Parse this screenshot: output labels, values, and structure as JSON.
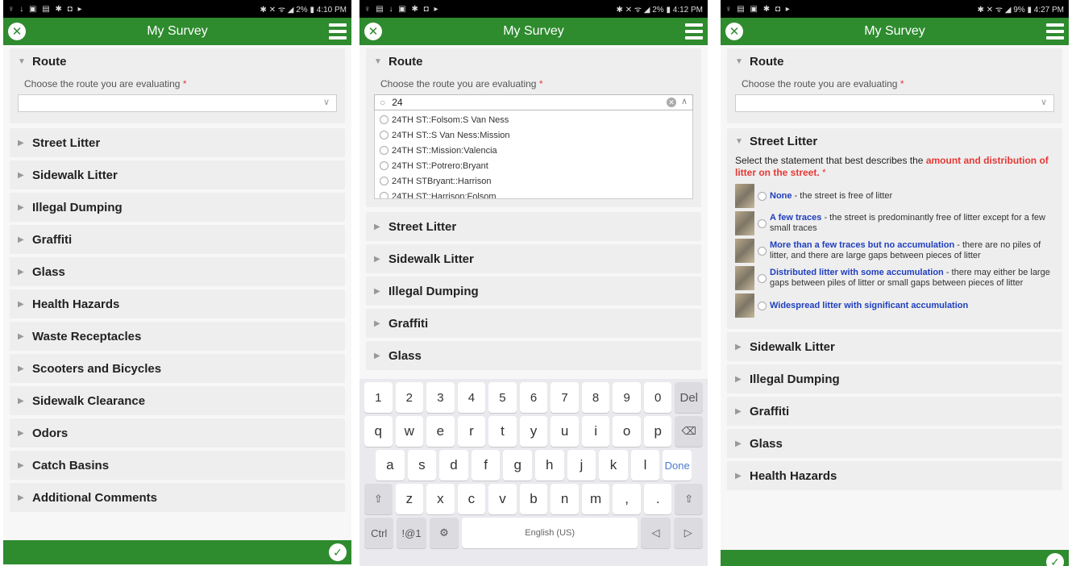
{
  "app": {
    "title": "My Survey"
  },
  "screens": [
    {
      "status_left": "♀ ↓ ▣ ▤ ✱ ◘ ▸",
      "status_right": "✱ ✕ ᯤ ◢ 2% ▮ 4:10 PM",
      "route_label": "Route",
      "route_question": "Choose the route you are evaluating",
      "required_mark": "*",
      "sections": [
        "Street Litter",
        "Sidewalk Litter",
        "Illegal Dumping",
        "Graffiti",
        "Glass",
        "Health Hazards",
        "Waste Receptacles",
        "Scooters and Bicycles",
        "Sidewalk Clearance",
        "Odors",
        "Catch Basins",
        "Additional Comments"
      ]
    },
    {
      "status_left": "♀ ▤ ↓ ▣ ✱ ◘ ▸",
      "status_right": "✱ ✕ ᯤ ◢ 2% ▮ 4:12 PM",
      "route_label": "Route",
      "route_question": "Choose the route you are evaluating",
      "required_mark": "*",
      "search_value": "24",
      "options": [
        "24TH ST::Folsom:S Van Ness",
        "24TH ST::S Van Ness:Mission",
        "24TH ST::Mission:Valencia",
        "24TH ST::Potrero:Bryant",
        "24TH STBryant::Harrison",
        "24TH ST::Harrison:Folsom"
      ],
      "sections": [
        "Street Litter",
        "Sidewalk Litter",
        "Illegal Dumping",
        "Graffiti",
        "Glass"
      ],
      "keyboard": {
        "row1": [
          "1",
          "2",
          "3",
          "4",
          "5",
          "6",
          "7",
          "8",
          "9",
          "0",
          "Del"
        ],
        "row2": [
          "q",
          "w",
          "e",
          "r",
          "t",
          "y",
          "u",
          "i",
          "o",
          "p",
          "⌫"
        ],
        "row3": [
          "a",
          "s",
          "d",
          "f",
          "g",
          "h",
          "j",
          "k",
          "l",
          "Done"
        ],
        "row4": [
          "⇧",
          "z",
          "x",
          "c",
          "v",
          "b",
          "n",
          "m",
          ",",
          ".",
          "⇧"
        ],
        "ctrl": "Ctrl",
        "sym": "!@1",
        "gear": "⚙",
        "space": "English (US)",
        "left": "◁",
        "right": "▷"
      }
    },
    {
      "status_left": "♀ ▤ ▣ ✱ ◘ ▸",
      "status_right": "✱ ✕ ᯤ ◢ 9% ▮ 4:27 PM",
      "route_label": "Route",
      "route_question": "Choose the route you are evaluating",
      "required_mark": "*",
      "litter_label": "Street Litter",
      "litter_question_pre": "Select the statement that best describes the ",
      "litter_question_hl": "amount and distribution of litter on the street.",
      "choices": [
        {
          "label": "None",
          "desc": " - the street is free of litter"
        },
        {
          "label": "A few traces",
          "desc": " - the street is predominantly free of litter except for a few small traces"
        },
        {
          "label": "More than a few traces but no accumulation",
          "desc": " - there are no piles of litter, and there are large gaps between pieces of litter"
        },
        {
          "label": "Distributed litter with some accumulation",
          "desc": " - there may either be large gaps between piles of litter or small gaps between pieces of litter"
        },
        {
          "label": "Widespread litter with significant accumulation",
          "desc": ""
        }
      ],
      "sections": [
        "Sidewalk Litter",
        "Illegal Dumping",
        "Graffiti",
        "Glass",
        "Health Hazards"
      ]
    }
  ],
  "icons": {
    "close": "✕",
    "check": "✓",
    "collapsed_arrow": "▶",
    "expanded_arrow": "▼",
    "chevron_down": "∨",
    "chevron_up": "∧",
    "search": "○",
    "clear": "✕"
  },
  "colors": {
    "header_green": "#2e8b2e",
    "required_red": "#e53935",
    "choice_blue": "#1f3fbf"
  }
}
